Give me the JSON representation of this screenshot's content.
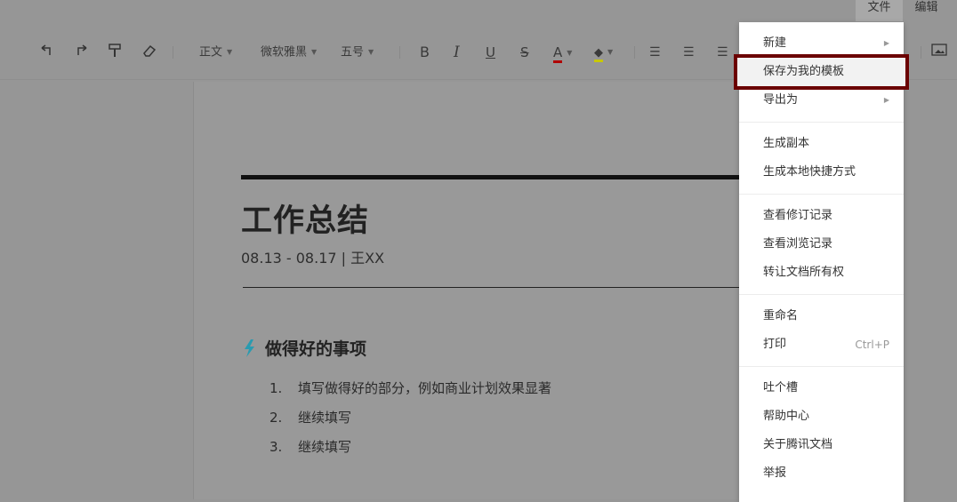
{
  "menubar": {
    "file": "文件",
    "edit": "编辑"
  },
  "toolbar": {
    "style": "正文",
    "font": "微软雅黑",
    "size": "五号",
    "bold": "B",
    "italic": "I",
    "underline": "U",
    "strike": "S",
    "fontcolor": "A",
    "colors": {
      "font": "#b00000",
      "highlight": "#c8c800"
    }
  },
  "doc": {
    "title": "工作总结",
    "meta": "08.13 - 08.17 | 王XX",
    "section": "做得好的事项",
    "items": [
      {
        "n": "1.",
        "t": "填写做得好的部分，例如商业计划效果显著"
      },
      {
        "n": "2.",
        "t": "继续填写"
      },
      {
        "n": "3.",
        "t": "继续填写"
      }
    ]
  },
  "menu": {
    "groups": [
      [
        {
          "label": "新建",
          "sub": true
        },
        {
          "label": "保存为我的模板",
          "highlight": true
        },
        {
          "label": "导出为",
          "sub": true
        }
      ],
      [
        {
          "label": "生成副本"
        },
        {
          "label": "生成本地快捷方式"
        }
      ],
      [
        {
          "label": "查看修订记录"
        },
        {
          "label": "查看浏览记录"
        },
        {
          "label": "转让文档所有权"
        }
      ],
      [
        {
          "label": "重命名"
        },
        {
          "label": "打印",
          "shortcut": "Ctrl+P"
        }
      ],
      [
        {
          "label": "吐个槽"
        },
        {
          "label": "帮助中心"
        },
        {
          "label": "关于腾讯文档"
        },
        {
          "label": "举报"
        }
      ]
    ]
  },
  "highlight_color": "#6b0000"
}
